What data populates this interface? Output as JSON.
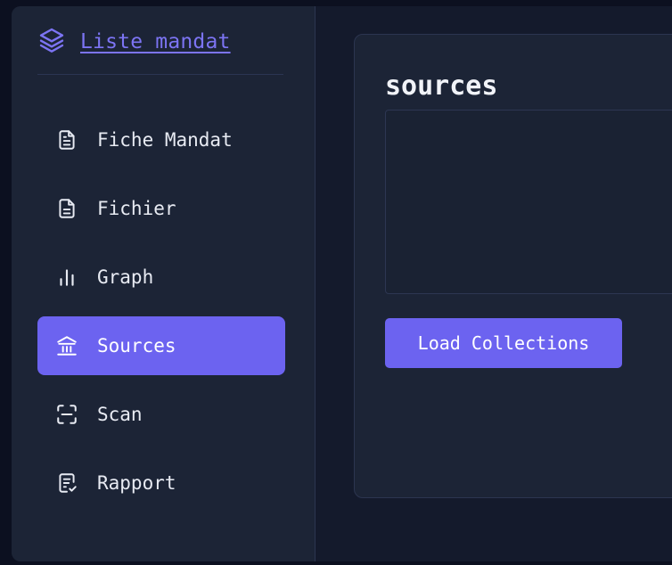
{
  "sidebar": {
    "brand": {
      "label": "Liste mandat",
      "icon": "layers-icon"
    },
    "items": [
      {
        "label": "Fiche Mandat",
        "icon": "file-text-icon",
        "active": false
      },
      {
        "label": "Fichier",
        "icon": "file-icon",
        "active": false
      },
      {
        "label": "Graph",
        "icon": "bar-chart-icon",
        "active": false
      },
      {
        "label": "Sources",
        "icon": "library-icon",
        "active": true
      },
      {
        "label": "Scan",
        "icon": "scan-icon",
        "active": false
      },
      {
        "label": "Rapport",
        "icon": "report-check-icon",
        "active": false
      }
    ]
  },
  "main": {
    "title": "sources",
    "load_button_label": "Load Collections"
  },
  "colors": {
    "accent": "#6c63f0",
    "brand_link": "#7c74f3",
    "sidebar_bg": "#1c2436",
    "page_bg": "#0c1020"
  }
}
